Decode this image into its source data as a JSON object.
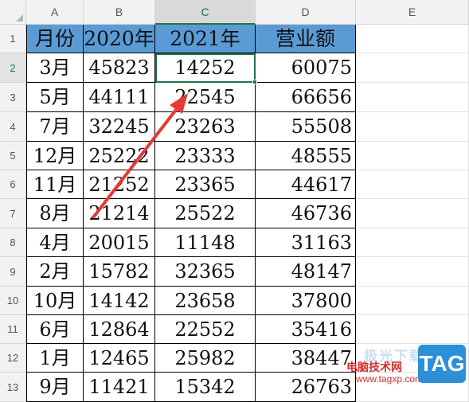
{
  "columns": [
    "A",
    "B",
    "C",
    "D",
    "E"
  ],
  "rows": [
    "1",
    "2",
    "3",
    "4",
    "5",
    "6",
    "7",
    "8",
    "9",
    "10",
    "11",
    "12",
    "13"
  ],
  "active_cell": {
    "column": "C",
    "row": "2"
  },
  "table": {
    "headers": [
      "月份",
      "2020年",
      "2021年",
      "营业额"
    ],
    "rows": [
      [
        "3月",
        "45823",
        "14252",
        "60075"
      ],
      [
        "5月",
        "44111",
        "22545",
        "66656"
      ],
      [
        "7月",
        "32245",
        "23263",
        "55508"
      ],
      [
        "12月",
        "25222",
        "23333",
        "48555"
      ],
      [
        "11月",
        "21252",
        "23365",
        "44617"
      ],
      [
        "8月",
        "21214",
        "25522",
        "46736"
      ],
      [
        "4月",
        "20015",
        "11148",
        "31163"
      ],
      [
        "2月",
        "15782",
        "32365",
        "48147"
      ],
      [
        "10月",
        "14142",
        "23658",
        "37800"
      ],
      [
        "6月",
        "12864",
        "22552",
        "35416"
      ],
      [
        "1月",
        "12465",
        "25982",
        "38447"
      ],
      [
        "9月",
        "11421",
        "15342",
        "26763"
      ]
    ]
  },
  "colors": {
    "header_fill": "#5b9bd5",
    "selection": "#217346",
    "arrow": "#e53935"
  },
  "watermark": {
    "line1": "极光下载站",
    "line2": "电脑技术网",
    "url": "www.tagxp.com",
    "badge": "TAG"
  }
}
